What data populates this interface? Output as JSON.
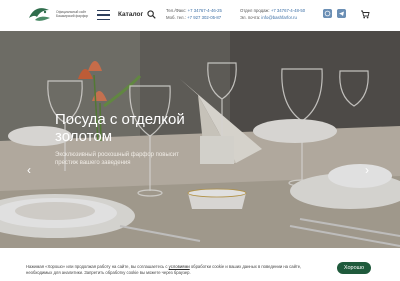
{
  "header": {
    "logo_text": "Официальный сайт Башкирский фарфор",
    "catalog_label": "Каталог",
    "contacts_left": {
      "tel_label": "Тел./Факс:",
      "tel_value": "+7 34767-4-46-25",
      "mob_label": "Моб. тел.:",
      "mob_value": "+7 927 302-05-87"
    },
    "contacts_right": {
      "sales_label": "Отдел продаж:",
      "sales_value": "+7 34767-4-48-50",
      "email_label": "Эл. почта:",
      "email_value": "info@bashfarfor.ru"
    }
  },
  "hero": {
    "title": "Посуда с отделкой золотом",
    "subtitle": "Эксклюзивный роскошный фарфор повысит престиж вашего заведения"
  },
  "cookie": {
    "text_before": "Нажимая «Хорошо» или продолжая работу на сайте, вы соглашаетесь с",
    "link_text": "условиями",
    "text_after": "обработки cookie и ваших данных в поведении на сайте, необходимых для аналитики. Запретить обработку cookie вы можете через браузер.",
    "button_label": "Хорошо"
  },
  "colors": {
    "accent": "#1f5a3c",
    "link": "#3a6ea5",
    "burger": "#2e3f5c"
  }
}
